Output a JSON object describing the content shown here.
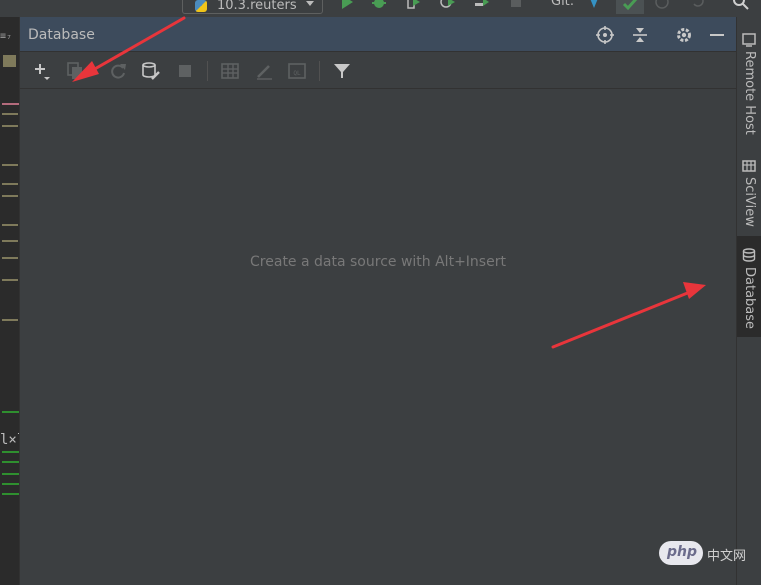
{
  "top_toolbar": {
    "run_config_label": "10.3.reuters",
    "vcs_label": "Git:"
  },
  "left_strip": {
    "top_glyph": "≡₇",
    "fragment_text": "l×l"
  },
  "database_panel": {
    "title": "Database",
    "empty_message": "Create a data source with Alt+Insert"
  },
  "right_strip": {
    "tabs": [
      {
        "label": "Remote Host",
        "icon": "remote-host-icon",
        "active": false
      },
      {
        "label": "SciView",
        "icon": "sciview-icon",
        "active": false
      },
      {
        "label": "Database",
        "icon": "database-icon",
        "active": true
      }
    ]
  },
  "watermark": {
    "logo_text": "php",
    "site_text": "中文网"
  },
  "colors": {
    "annotation_arrow": "#e8353b",
    "run_green": "#499c54",
    "header_blue": "#3d4b5c",
    "background": "#3c3f41"
  }
}
